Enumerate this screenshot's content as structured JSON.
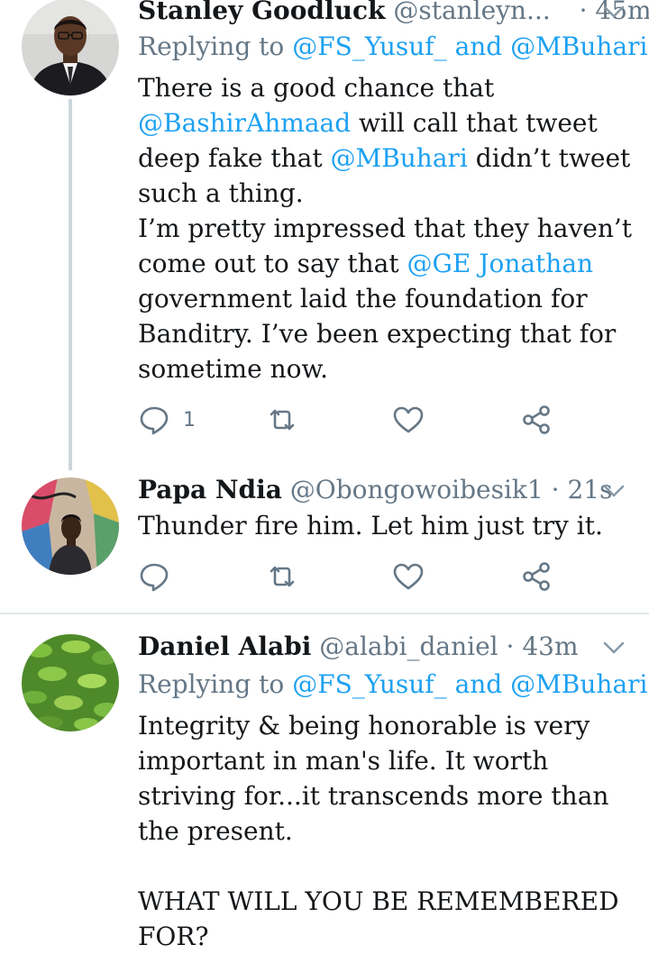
{
  "tweets": [
    {
      "name": "Stanley Goodluck",
      "handle": "@stanleyn...",
      "dot": "·",
      "time": "45m",
      "replying_prefix": "Replying to",
      "replying_user1": "@FS_Yusuf_",
      "replying_and": "and",
      "replying_user2": "@MBuhari",
      "body": {
        "l1": "There is a good chance that",
        "m1": "@BashirAhmaad",
        "l2": "will call that tweet deep fake that",
        "m2": "@MBuhari",
        "l3": "didn’t tweet such a thing.",
        "l4": "I’m pretty impressed that they haven’t come out to say that",
        "m3": "@GE Jonathan",
        "l5": "government laid the foundation for Banditry. I’ve been expecting that for sometime now."
      },
      "reply_count": "1",
      "avatar_icon": "person-suit-avatar"
    },
    {
      "name": "Papa Ndia",
      "handle": "@Obongowoibesik1",
      "dot": "·",
      "time": "21s",
      "body_text": "Thunder fire him. Let him just try it.",
      "reply_count": "",
      "avatar_icon": "person-graffiti-avatar"
    },
    {
      "name": "Daniel Alabi",
      "handle": "@alabi_daniel",
      "dot": "·",
      "time": "43m",
      "replying_prefix": "Replying to",
      "replying_user1": "@FS_Yusuf_",
      "replying_and": "and",
      "replying_user2": "@MBuhari",
      "body_p1": "Integrity & being honorable is very important in man's life. It worth striving for...it transcends more than the present.",
      "body_p2": "WHAT WILL YOU BE REMEMBERED FOR?",
      "avatar_icon": "green-leaves-avatar"
    }
  ],
  "colors": {
    "link": "#1da1f2",
    "secondary": "#657786",
    "thread_line": "#ccd6dd",
    "divider": "#e1e8ed"
  },
  "icons": [
    "reply-icon",
    "retweet-icon",
    "like-icon",
    "share-icon",
    "chevron-down-icon"
  ]
}
